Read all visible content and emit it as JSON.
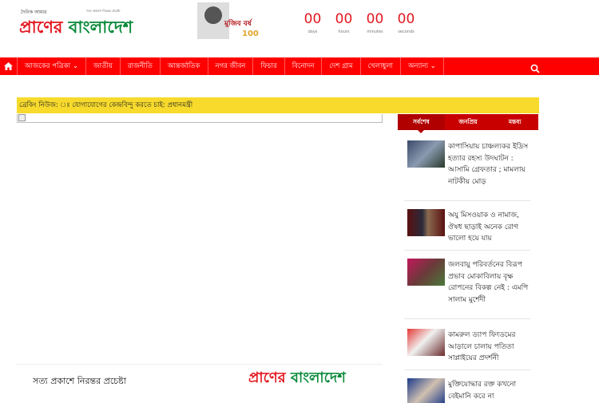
{
  "header": {
    "logo_tagline": "দৈনিক আমার",
    "logo_part_red": "প্রাণের",
    "logo_part_green": "বাংলাদেশ",
    "logo_subtext": "সত্য প্রকাশে নিরন্তর প্রচেষ্টা",
    "banner_text": "মুজিব বর্ষ",
    "banner_number": "100",
    "countdown": [
      {
        "value": "00",
        "label": "days"
      },
      {
        "value": "00",
        "label": "hours"
      },
      {
        "value": "00",
        "label": "minutes"
      },
      {
        "value": "00",
        "label": "seconds"
      }
    ]
  },
  "nav": {
    "items": [
      "আজকের পত্রিকা ⌄",
      "জাতীয়",
      "রাজনীতি",
      "আন্তর্জাতিক",
      "নগর জীবন",
      "ফিচার",
      "বিনোদন",
      "দেশ গ্রাম",
      "খেলাধুলা",
      "অন্যান্য ⌄"
    ],
    "accent": "#ff0000"
  },
  "breaking": {
    "text": "ব্রেকিং নিউজ: ঃ যোগাযোগের কেন্দ্রবিন্দু করতে চাই: প্রধানমন্ত্রী"
  },
  "footer_strip": {
    "slogan": "সত্য প্রকাশে নিরন্তর প্রচেষ্টা",
    "logo_red": "প্রাণের",
    "logo_green": "বাংলাদেশ"
  },
  "sidebar": {
    "tabs": [
      "সর্বশেষ",
      "জনপ্রিয়",
      "মন্তব্য"
    ],
    "items": [
      {
        "title": "কাপাসিয়ায় চাঞ্চল্যকর ইদ্রিস হত্যার রহস্য উদঘাটন : আসামি গ্রেফতার ; মামলায় নাটকীয় মোড়"
      },
      {
        "title": "অযু মিসওয়াক ও নামাজ, ঔষধ ছাড়াই অনেক রোগ ভালো হয়ে যায়"
      },
      {
        "title": "জলবায়ু পরিবর্তনের বিরূপ প্রভাব মোকাবিলায় বৃক্ষ রোপনের বিকল্প নেই : এমপি সালাম মুর্শেদী"
      },
      {
        "title": "কামরুল ড্যাপ ফিংডমের আড়ালে চালায় পতিতা সাপ্লাইয়ের প্রদর্শনী"
      },
      {
        "title": "মুক্তিযোদ্ধার রক্ত কখনো বেইমানি করে না"
      }
    ]
  }
}
